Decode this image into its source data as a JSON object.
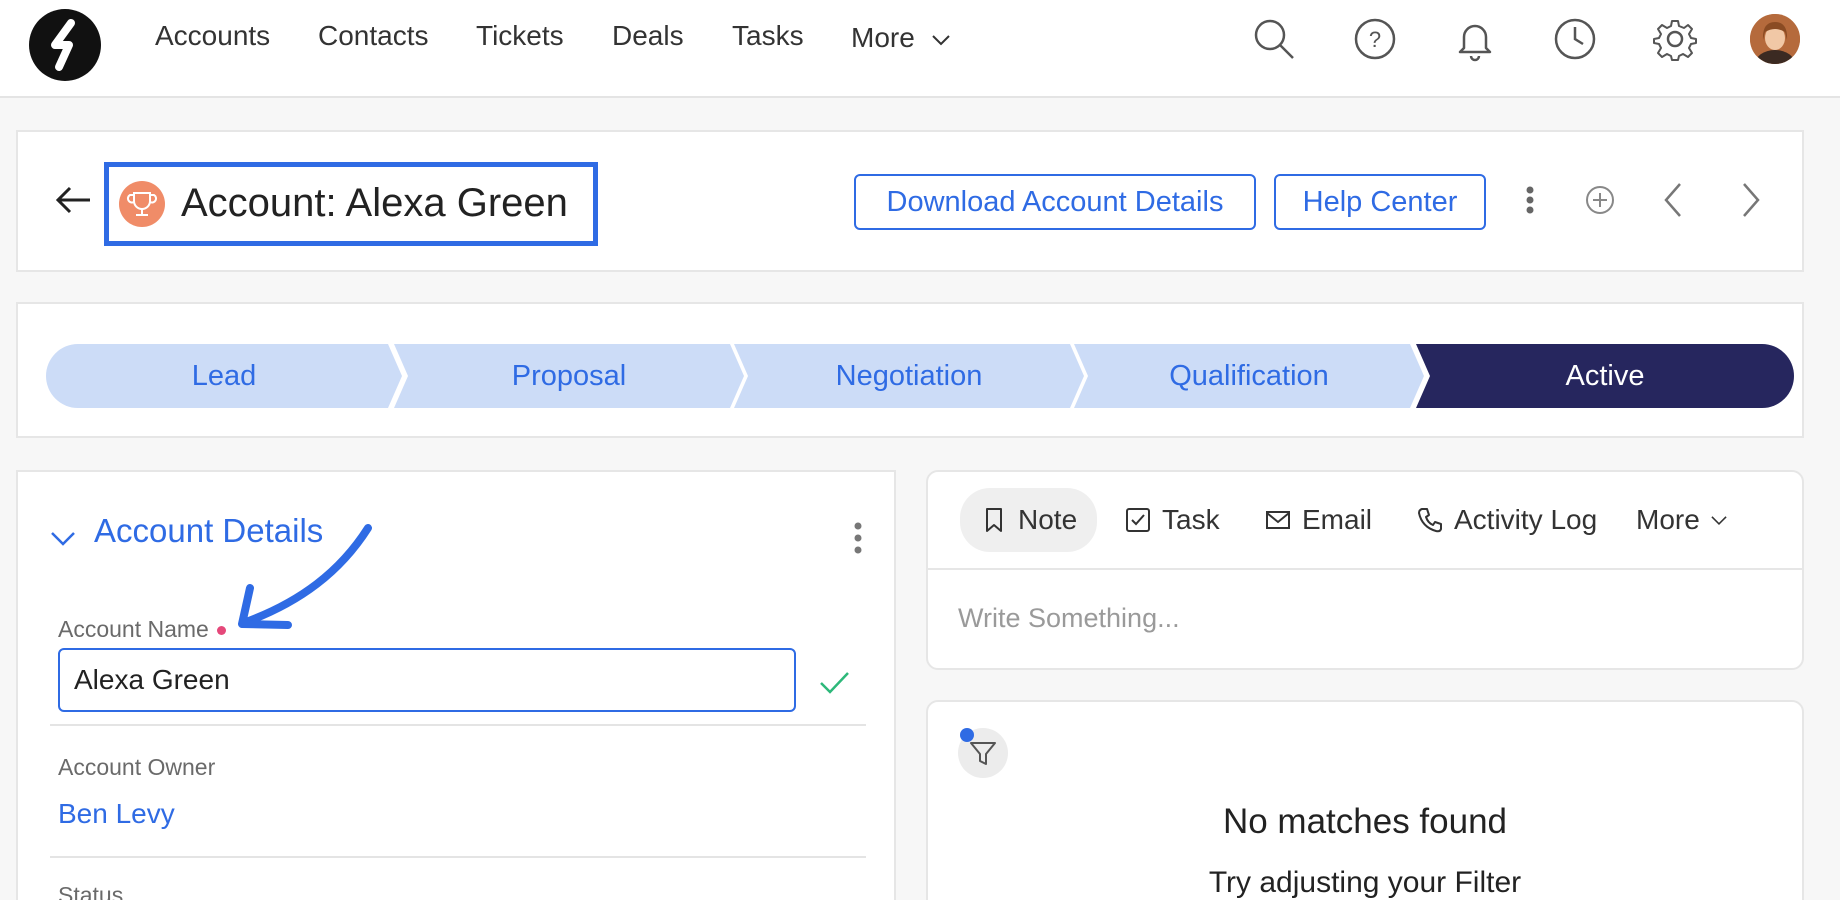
{
  "nav": {
    "items": [
      "Accounts",
      "Contacts",
      "Tickets",
      "Deals",
      "Tasks"
    ],
    "more_label": "More"
  },
  "header": {
    "title": "Account: Alexa Green",
    "download_label": "Download Account Details",
    "help_label": "Help Center"
  },
  "pipeline": {
    "stages": [
      "Lead",
      "Proposal",
      "Negotiation",
      "Qualification",
      "Active"
    ],
    "active_stage": "Active"
  },
  "details": {
    "section_title": "Account Details",
    "account_name_label": "Account Name",
    "account_name_value": "Alexa Green",
    "owner_label": "Account Owner",
    "owner_value": "Ben Levy",
    "status_label": "Status"
  },
  "composer": {
    "tabs": [
      "Note",
      "Task",
      "Email",
      "Activity Log"
    ],
    "more_label": "More",
    "placeholder": "Write Something..."
  },
  "feed": {
    "empty_title": "No matches found",
    "empty_subtitle": "Try adjusting your Filter"
  },
  "colors": {
    "accent": "#2f6be4",
    "stage_inactive": "#ccdcf7",
    "stage_active": "#26265e",
    "trophy": "#f08c68",
    "required": "#e5487a",
    "success": "#2db87a"
  }
}
